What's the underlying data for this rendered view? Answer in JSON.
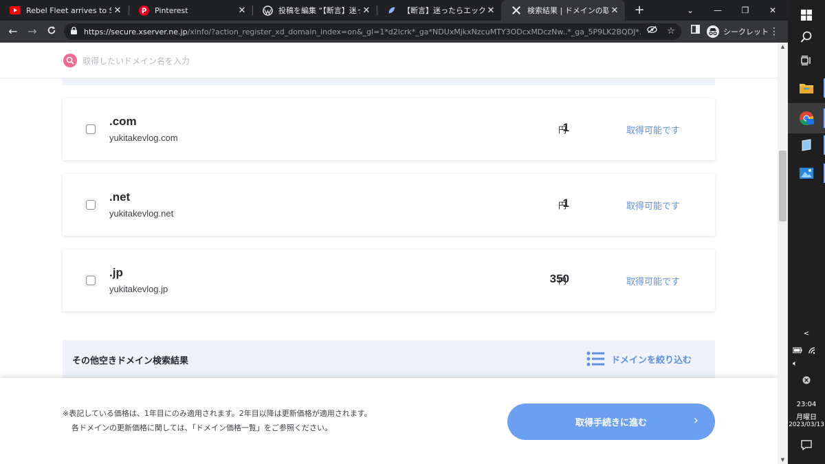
{
  "browser": {
    "tabs": [
      {
        "title": "Rebel Fleet arrives to Scarif",
        "icon": "youtube-icon",
        "color": "#ff0000"
      },
      {
        "title": "Pinterest",
        "icon": "pinterest-icon",
        "color": "#e60023"
      },
      {
        "title": "投稿を編集 “【断言】迷ったら",
        "icon": "wordpress-icon",
        "color": "#e8eaed"
      },
      {
        "title": "【断言】迷ったらエックスサーバー",
        "icon": "site-icon",
        "color": "#8ab4f8"
      },
      {
        "title": "検索結果 | ドメインの取得も",
        "icon": "xserver-icon",
        "color": "#e8eaed"
      }
    ],
    "url_host": "https://secure.xserver.ne.jp",
    "url_rest": "/xinfo/?action_register_xd_domain_index=on&_gl=1*d2lcrk*_ga*NDUxMjkxNzcuMTY3ODcxMDczNw..*_ga_5P9LK2BQDJ*...",
    "incognito_label": "シークレット"
  },
  "search": {
    "placeholder": "取得したいドメイン名を入力"
  },
  "domains": [
    {
      "tld": ".com",
      "name": "yukitakevlog.com",
      "price": "1",
      "currency": "円",
      "status": "取得可能です"
    },
    {
      "tld": ".net",
      "name": "yukitakevlog.net",
      "price": "1",
      "currency": "円",
      "status": "取得可能です"
    },
    {
      "tld": ".jp",
      "name": "yukitakevlog.jp",
      "price": "350",
      "currency": "円",
      "status": "取得可能です"
    }
  ],
  "other_results": {
    "title": "その他空きドメイン検索結果",
    "filter_label": "ドメインを絞り込む"
  },
  "footer": {
    "note_line1": "※表記している価格は、1年目にのみ適用されます。2年目以降は更新価格が適用されます。",
    "note_line2": "各ドメインの更新価格に関しては、「ドメイン価格一覧」をご参照ください。",
    "cta_label": "取得手続きに進む"
  },
  "taskbar": {
    "time": "23:04",
    "weekday": "月曜日",
    "date": "2023/03/13"
  },
  "colors": {
    "accent": "#6a9ff2",
    "available_text": "#5f8fe0",
    "search_icon": "#f56a92"
  }
}
